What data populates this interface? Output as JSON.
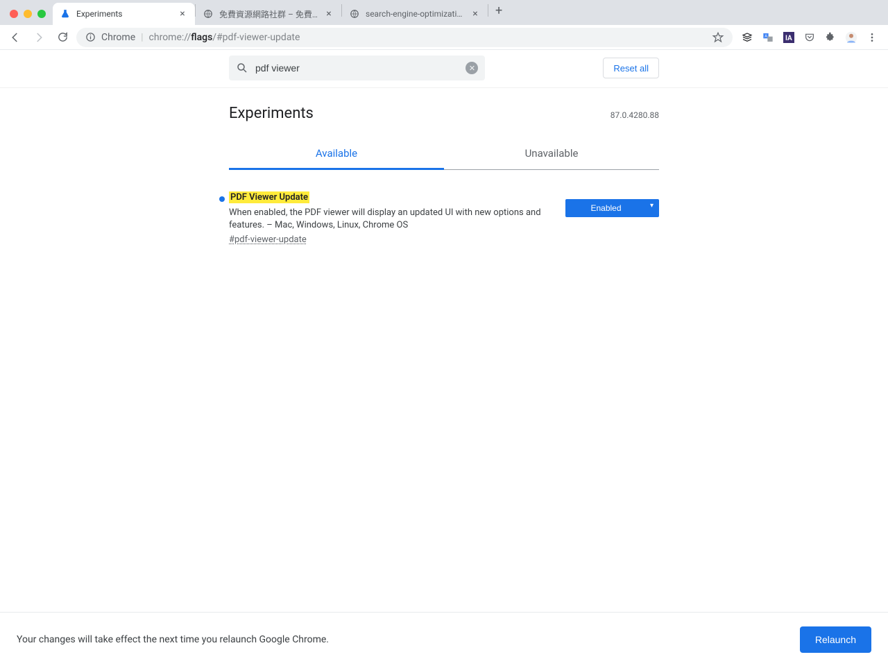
{
  "tabs": [
    {
      "title": "Experiments"
    },
    {
      "title": "免費資源網路社群 – 免費資源指南"
    },
    {
      "title": "search-engine-optimization-st"
    }
  ],
  "omnibox": {
    "origin": "Chrome",
    "url_prefix": "chrome://",
    "url_bold": "flags",
    "url_rest": "/#pdf-viewer-update"
  },
  "search": {
    "value": "pdf viewer",
    "reset_label": "Reset all"
  },
  "page": {
    "title": "Experiments",
    "version": "87.0.4280.88",
    "tab_available": "Available",
    "tab_unavailable": "Unavailable"
  },
  "flag": {
    "title": "PDF Viewer Update",
    "description": "When enabled, the PDF viewer will display an updated UI with new options and features. – Mac, Windows, Linux, Chrome OS",
    "anchor": "#pdf-viewer-update",
    "state": "Enabled"
  },
  "relaunch": {
    "message": "Your changes will take effect the next time you relaunch Google Chrome.",
    "button": "Relaunch"
  }
}
